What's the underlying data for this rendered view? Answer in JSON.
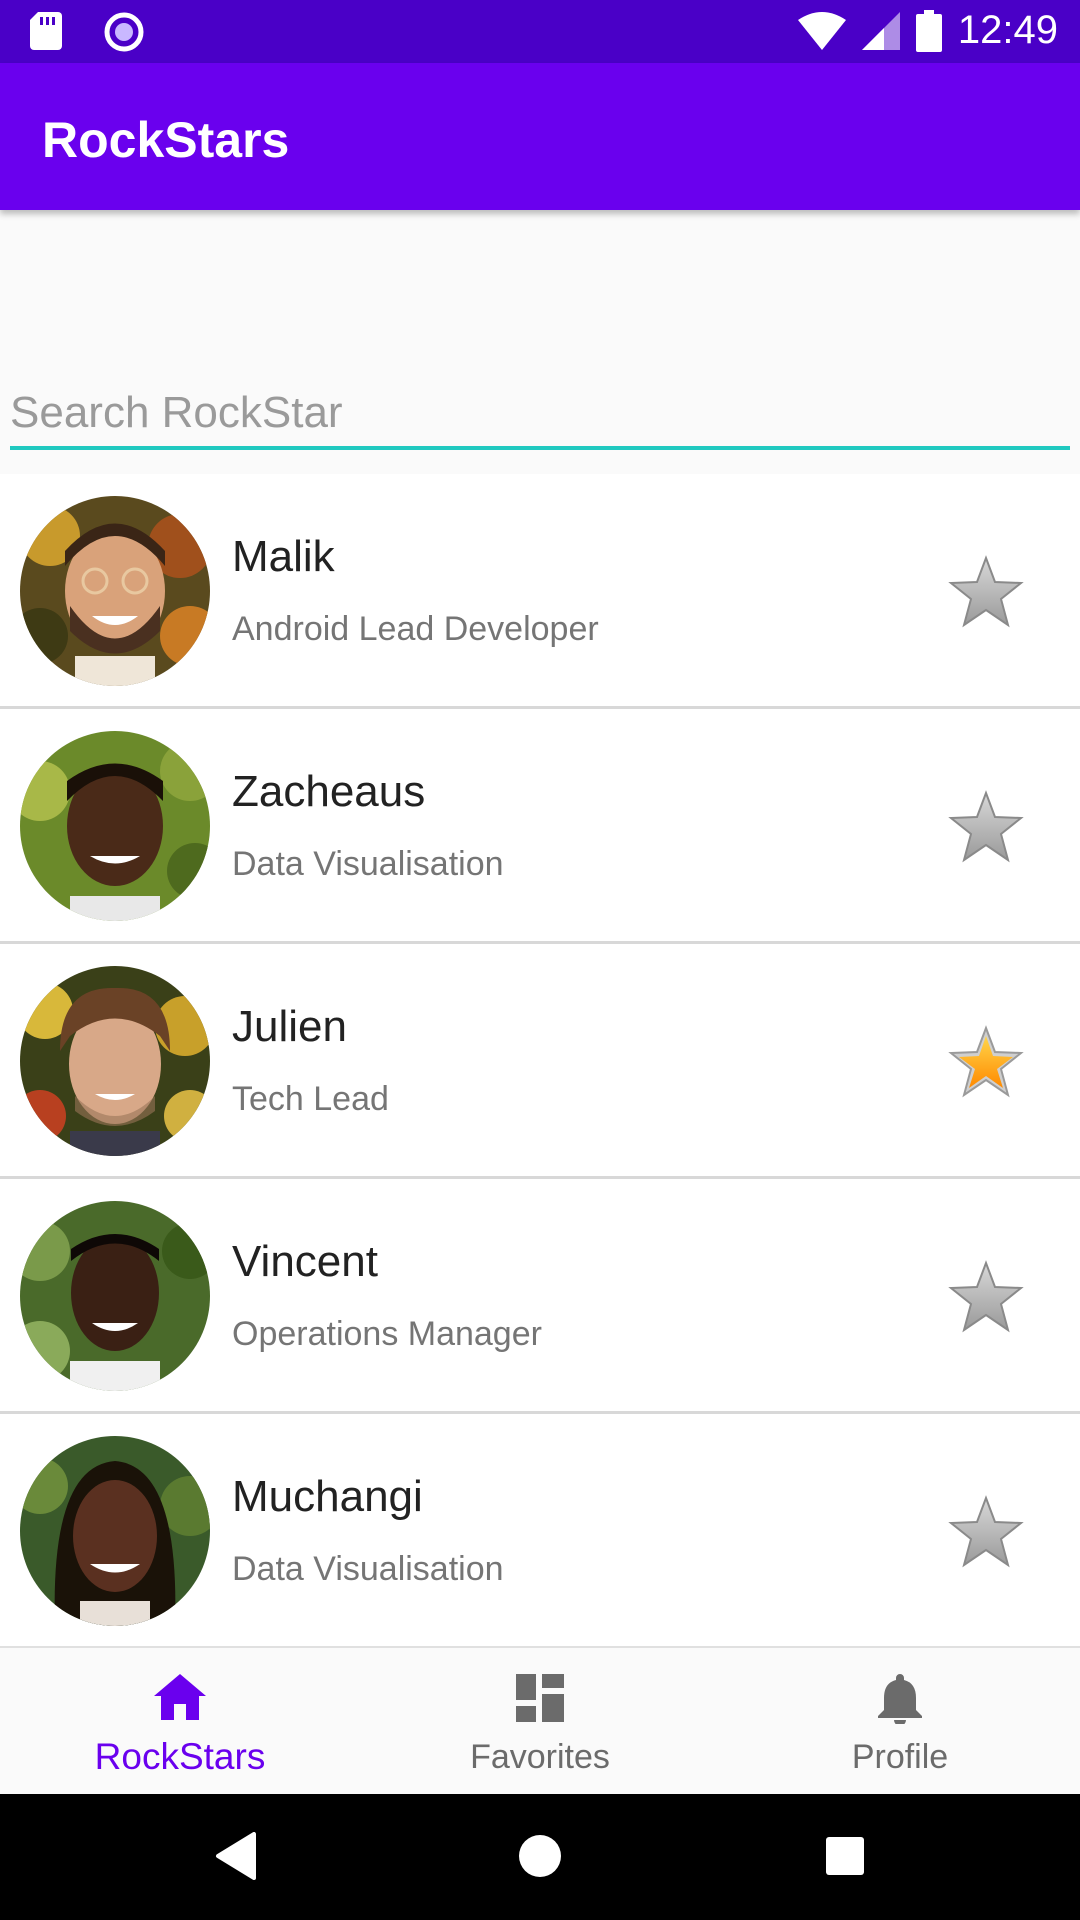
{
  "status_bar": {
    "time": "12:49"
  },
  "app_bar": {
    "title": "RockStars"
  },
  "search": {
    "placeholder": "Search RockStar",
    "value": ""
  },
  "rockstars": [
    {
      "name": "Malik",
      "role": "Android Lead Developer",
      "favorite": false
    },
    {
      "name": "Zacheaus",
      "role": "Data Visualisation",
      "favorite": false
    },
    {
      "name": "Julien",
      "role": "Tech Lead",
      "favorite": true
    },
    {
      "name": "Vincent",
      "role": "Operations Manager",
      "favorite": false
    },
    {
      "name": "Muchangi",
      "role": "Data Visualisation",
      "favorite": false
    }
  ],
  "bottom_nav": {
    "items": [
      {
        "label": "RockStars",
        "icon": "home-icon",
        "active": true
      },
      {
        "label": "Favorites",
        "icon": "dashboard-icon",
        "active": false
      },
      {
        "label": "Profile",
        "icon": "bell-icon",
        "active": false
      }
    ]
  },
  "colors": {
    "primary": "#6a00ee",
    "primary_dark": "#4a00c7",
    "accent": "#20c9c0",
    "star_active": "#ff9800"
  }
}
